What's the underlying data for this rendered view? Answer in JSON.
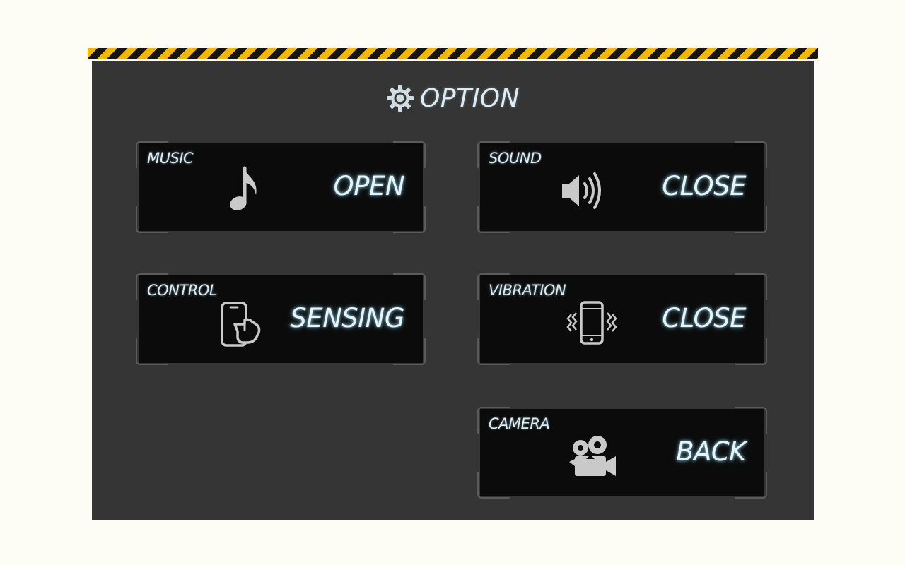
{
  "header": {
    "title": "OPTION",
    "icon": "gear-icon"
  },
  "options": [
    {
      "label": "MUSIC",
      "value": "OPEN",
      "icon": "music-note-icon"
    },
    {
      "label": "SOUND",
      "value": "CLOSE",
      "icon": "speaker-icon"
    },
    {
      "label": "CONTROL",
      "value": "SENSING",
      "icon": "phone-touch-icon"
    },
    {
      "label": "VIBRATION",
      "value": "CLOSE",
      "icon": "phone-vibrate-icon"
    },
    {
      "label": "CAMERA",
      "value": "BACK",
      "icon": "video-camera-icon"
    }
  ],
  "colors": {
    "hazard_yellow": "#f5b800",
    "hazard_black": "#151515",
    "panel": "#353535",
    "card": "#0b0b0b",
    "text_glow": "#dcecf2"
  }
}
